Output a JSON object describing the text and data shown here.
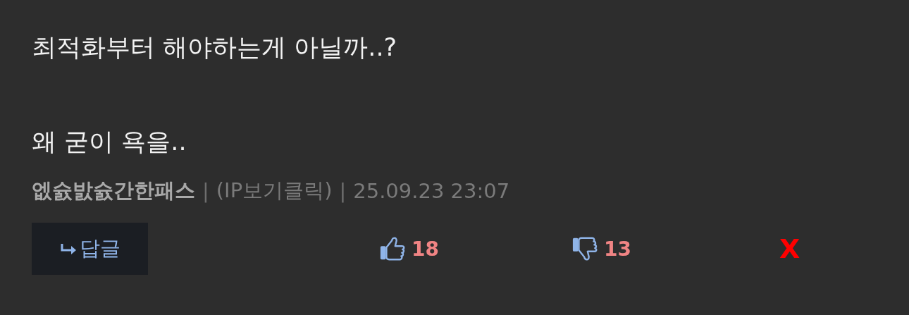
{
  "comment": {
    "lines": [
      "최적화부터 해야하는게 아닐까..?",
      "왜 굳이 욕을.."
    ],
    "author": "엢슔밠슔간한패스",
    "separators": [
      "|",
      "|"
    ],
    "ip_link": "(IP보기클릭)",
    "date": "25.09.23 23:07"
  },
  "actions": {
    "reply_label": "답글",
    "likes": "18",
    "dislikes": "13",
    "delete": "X"
  }
}
